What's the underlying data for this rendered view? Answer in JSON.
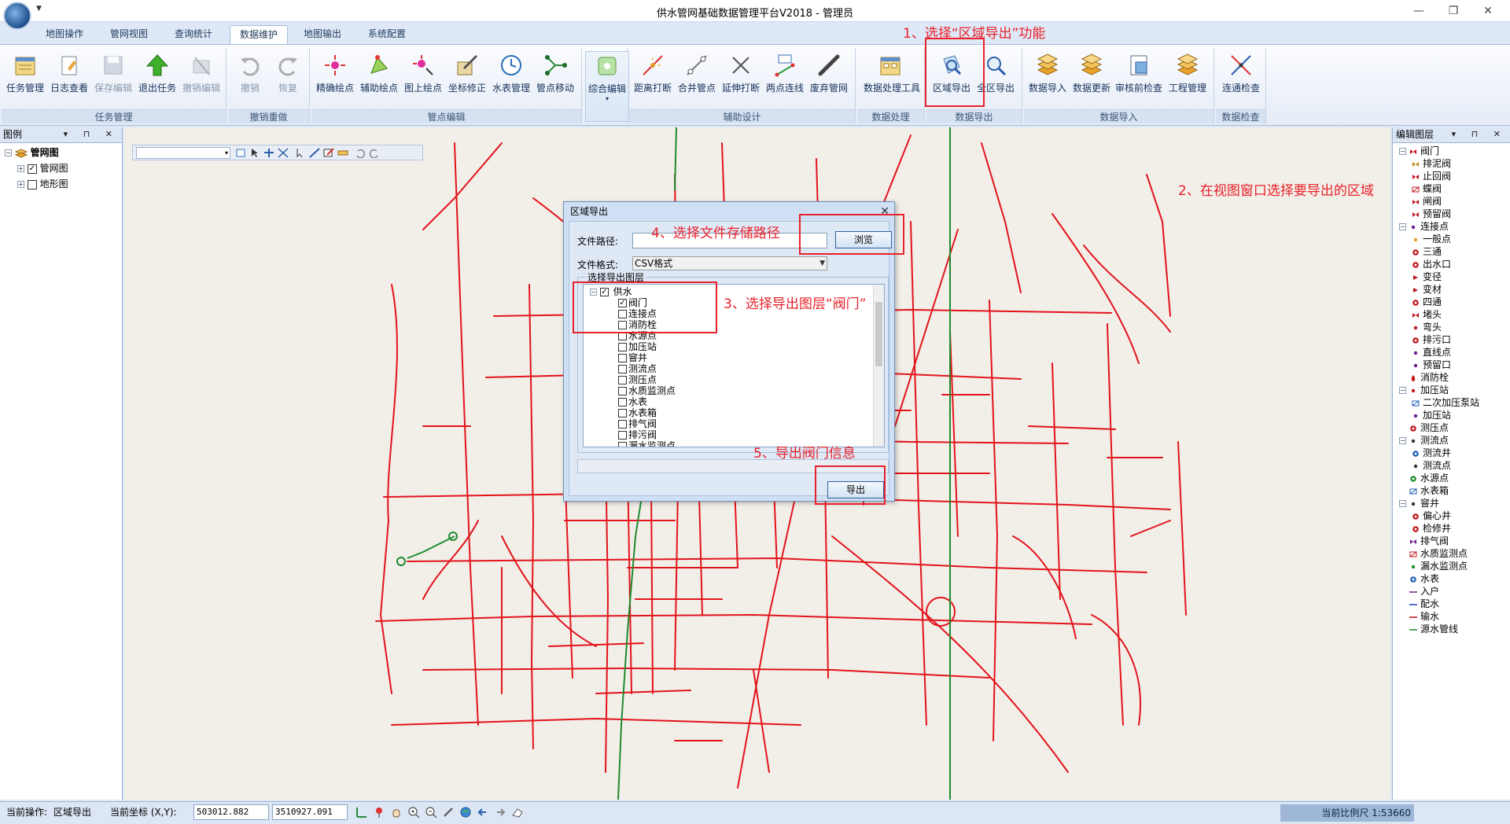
{
  "window": {
    "title": "供水管网基础数据管理平台V2018 - 管理员",
    "controls": {
      "minimize": "—",
      "restore": "❐",
      "close": "✕"
    }
  },
  "tabs": [
    {
      "label": "地图操作"
    },
    {
      "label": "管网视图"
    },
    {
      "label": "查询统计"
    },
    {
      "label": "数据维护",
      "active": true
    },
    {
      "label": "地图输出"
    },
    {
      "label": "系统配置"
    }
  ],
  "ribbon": {
    "groups": [
      {
        "label": "任务管理",
        "buttons": [
          {
            "label": "任务管理",
            "icon": "task-icon"
          },
          {
            "label": "日志查看",
            "icon": "log-icon"
          },
          {
            "label": "保存编辑",
            "icon": "save-icon",
            "disabled": true
          },
          {
            "label": "退出任务",
            "icon": "exit-task-icon"
          },
          {
            "label": "撤销编辑",
            "icon": "cancel-edit-icon",
            "disabled": true
          }
        ]
      },
      {
        "label": "撤销重做",
        "buttons": [
          {
            "label": "撤销",
            "icon": "undo-icon",
            "disabled": true
          },
          {
            "label": "恢复",
            "icon": "redo-icon",
            "disabled": true
          }
        ]
      },
      {
        "label": "管点编辑",
        "buttons": [
          {
            "label": "精确绘点",
            "icon": "precise-point-icon"
          },
          {
            "label": "辅助绘点",
            "icon": "assist-point-icon"
          },
          {
            "label": "图上绘点",
            "icon": "map-point-icon"
          },
          {
            "label": "坐标修正",
            "icon": "coord-fix-icon"
          },
          {
            "label": "水表管理",
            "icon": "meter-icon"
          },
          {
            "label": "管点移动",
            "icon": "point-move-icon"
          }
        ]
      },
      {
        "label": "",
        "buttons": [
          {
            "label": "综合编辑",
            "icon": "combined-edit-icon"
          }
        ]
      },
      {
        "label": "辅助设计",
        "buttons": [
          {
            "label": "距离打断",
            "icon": "distance-break-icon"
          },
          {
            "label": "合并管点",
            "icon": "merge-point-icon"
          },
          {
            "label": "延伸打断",
            "icon": "extend-break-icon"
          },
          {
            "label": "两点连线",
            "icon": "connect-icon"
          },
          {
            "label": "废弃管网",
            "icon": "abandon-icon"
          }
        ]
      },
      {
        "label": "数据处理",
        "buttons": [
          {
            "label": "数据处理工具",
            "icon": "data-tool-icon"
          }
        ]
      },
      {
        "label": "数据导出",
        "buttons": [
          {
            "label": "区域导出",
            "icon": "area-export-icon"
          },
          {
            "label": "全区导出",
            "icon": "full-export-icon"
          }
        ]
      },
      {
        "label": "数据导入",
        "buttons": [
          {
            "label": "数据导入",
            "icon": "import-icon"
          },
          {
            "label": "数据更新",
            "icon": "update-icon"
          },
          {
            "label": "审核前检查",
            "icon": "precheck-icon"
          },
          {
            "label": "工程管理",
            "icon": "project-icon"
          }
        ]
      },
      {
        "label": "数据检查",
        "buttons": [
          {
            "label": "连通检查",
            "icon": "connectivity-icon"
          }
        ]
      }
    ]
  },
  "left_panel": {
    "title": "图例",
    "header_buttons": "▾ ⊓ ✕",
    "tree": [
      {
        "label": "管网图",
        "level": 0
      },
      {
        "label": "管网图",
        "level": 1,
        "checked": true
      },
      {
        "label": "地形图",
        "level": 1,
        "checked": false
      }
    ]
  },
  "right_panel": {
    "title": "编辑图层",
    "items": [
      {
        "label": "阀门",
        "level": 0,
        "expander": "⊟",
        "sym": "valve",
        "color": "#c3161c"
      },
      {
        "label": "排泥阀",
        "level": 1,
        "sym": "valve",
        "color": "#c38a16"
      },
      {
        "label": "止回阀",
        "level": 1,
        "sym": "valve",
        "color": "#c3161c"
      },
      {
        "label": "蝶阀",
        "level": 1,
        "sym": "box",
        "color": "#c3161c"
      },
      {
        "label": "闸阀",
        "level": 1,
        "sym": "valve",
        "color": "#c3161c"
      },
      {
        "label": "预留阀",
        "level": 1,
        "sym": "valve",
        "color": "#c3161c"
      },
      {
        "label": "连接点",
        "level": 0,
        "expander": "⊟",
        "sym": "dot",
        "color": "#6b1d8c"
      },
      {
        "label": "一般点",
        "level": 1,
        "sym": "dot",
        "color": "#e0a01c"
      },
      {
        "label": "三通",
        "level": 1,
        "sym": "circle",
        "color": "#c3161c"
      },
      {
        "label": "出水口",
        "level": 1,
        "sym": "circle",
        "color": "#c3161c"
      },
      {
        "label": "变径",
        "level": 1,
        "sym": "tri",
        "color": "#c3161c"
      },
      {
        "label": "变材",
        "level": 1,
        "sym": "tri",
        "color": "#c3161c"
      },
      {
        "label": "四通",
        "level": 1,
        "sym": "circle",
        "color": "#c3161c"
      },
      {
        "label": "堵头",
        "level": 1,
        "sym": "valve",
        "color": "#c3161c"
      },
      {
        "label": "弯头",
        "level": 1,
        "sym": "dot",
        "color": "#c3161c"
      },
      {
        "label": "排污口",
        "level": 1,
        "sym": "circle",
        "color": "#c3161c"
      },
      {
        "label": "直线点",
        "level": 1,
        "sym": "dot",
        "color": "#6b1d8c"
      },
      {
        "label": "预留口",
        "level": 1,
        "sym": "dot",
        "color": "#6b1d8c"
      },
      {
        "label": "消防栓",
        "level": 0,
        "sym": "fire",
        "color": "#c3161c"
      },
      {
        "label": "加压站",
        "level": 0,
        "expander": "⊟",
        "sym": "dot",
        "color": "#c3161c"
      },
      {
        "label": "二次加压泵站",
        "level": 1,
        "sym": "box",
        "color": "#1e5fb7"
      },
      {
        "label": "加压站",
        "level": 1,
        "sym": "dot",
        "color": "#6b1d8c"
      },
      {
        "label": "测压点",
        "level": 0,
        "sym": "circle",
        "color": "#c3161c"
      },
      {
        "label": "测流点",
        "level": 0,
        "expander": "⊟",
        "sym": "dot",
        "color": "#333333"
      },
      {
        "label": "测流井",
        "level": 1,
        "sym": "circle",
        "color": "#1e5fb7"
      },
      {
        "label": "测流点",
        "level": 1,
        "sym": "dot",
        "color": "#333333"
      },
      {
        "label": "水源点",
        "level": 0,
        "sym": "circle",
        "color": "#1d8c2a"
      },
      {
        "label": "水表箱",
        "level": 0,
        "sym": "box",
        "color": "#1e5fb7"
      },
      {
        "label": "窨井",
        "level": 0,
        "expander": "⊟",
        "sym": "dot",
        "color": "#333333"
      },
      {
        "label": "偏心井",
        "level": 1,
        "sym": "circle",
        "color": "#c3161c"
      },
      {
        "label": "检修井",
        "level": 1,
        "sym": "circle",
        "color": "#c3161c"
      },
      {
        "label": "排气阀",
        "level": 0,
        "sym": "valve",
        "color": "#6b1d8c"
      },
      {
        "label": "水质监测点",
        "level": 0,
        "sym": "box",
        "color": "#c3161c"
      },
      {
        "label": "漏水监测点",
        "level": 0,
        "sym": "dot",
        "color": "#1d8c2a"
      },
      {
        "label": "水表",
        "level": 0,
        "sym": "circle",
        "color": "#1e5fb7"
      },
      {
        "label": "入户",
        "level": 0,
        "sym": "line",
        "color": "#6b1d8c"
      },
      {
        "label": "配水",
        "level": 0,
        "sym": "line",
        "color": "#1e3fb7"
      },
      {
        "label": "输水",
        "level": 0,
        "sym": "line",
        "color": "#c3161c"
      },
      {
        "label": "源水管线",
        "level": 0,
        "sym": "line",
        "color": "#1d8c2a"
      }
    ]
  },
  "map": {
    "toolbar_select": "▾"
  },
  "dialog": {
    "title": "区域导出",
    "close": "✕",
    "path_label": "文件路径:",
    "path_value": "",
    "browse_label": "浏览",
    "format_label": "文件格式:",
    "format_value": "CSV格式",
    "layer_group_label": "选择导出图层",
    "tree_root": "供水",
    "layers": [
      {
        "label": "阀门",
        "checked": true
      },
      {
        "label": "连接点",
        "checked": false
      },
      {
        "label": "消防栓",
        "checked": false
      },
      {
        "label": "水源点",
        "checked": false
      },
      {
        "label": "加压站",
        "checked": false
      },
      {
        "label": "窨井",
        "checked": false
      },
      {
        "label": "测流点",
        "checked": false
      },
      {
        "label": "测压点",
        "checked": false
      },
      {
        "label": "水质监测点",
        "checked": false
      },
      {
        "label": "水表",
        "checked": false
      },
      {
        "label": "水表箱",
        "checked": false
      },
      {
        "label": "排气阀",
        "checked": false
      },
      {
        "label": "排污阀",
        "checked": false
      },
      {
        "label": "漏水监测点",
        "checked": false
      }
    ],
    "export_label": "导出"
  },
  "annotations": [
    {
      "text": "1、选择“区域导出”功能"
    },
    {
      "text": "2、在视图窗口选择要导出的区域"
    },
    {
      "text": "3、选择导出图层“阀门”"
    },
    {
      "text": "4、选择文件存储路径"
    },
    {
      "text": "5、导出阀门信息"
    }
  ],
  "statusbar": {
    "op_label": "当前操作:",
    "op_value": "区域导出",
    "coord_label": "当前坐标 (X,Y):",
    "x": "503012.882",
    "y": "3510927.091",
    "scale": "当前比例尺 1:53660"
  },
  "colors": {
    "pipe": "#e3131b",
    "source_pipe": "#1f8a2e",
    "selection_fill": "#d9835a",
    "selection_stroke": "#6b7fc4",
    "annotation": "#e8212a"
  }
}
